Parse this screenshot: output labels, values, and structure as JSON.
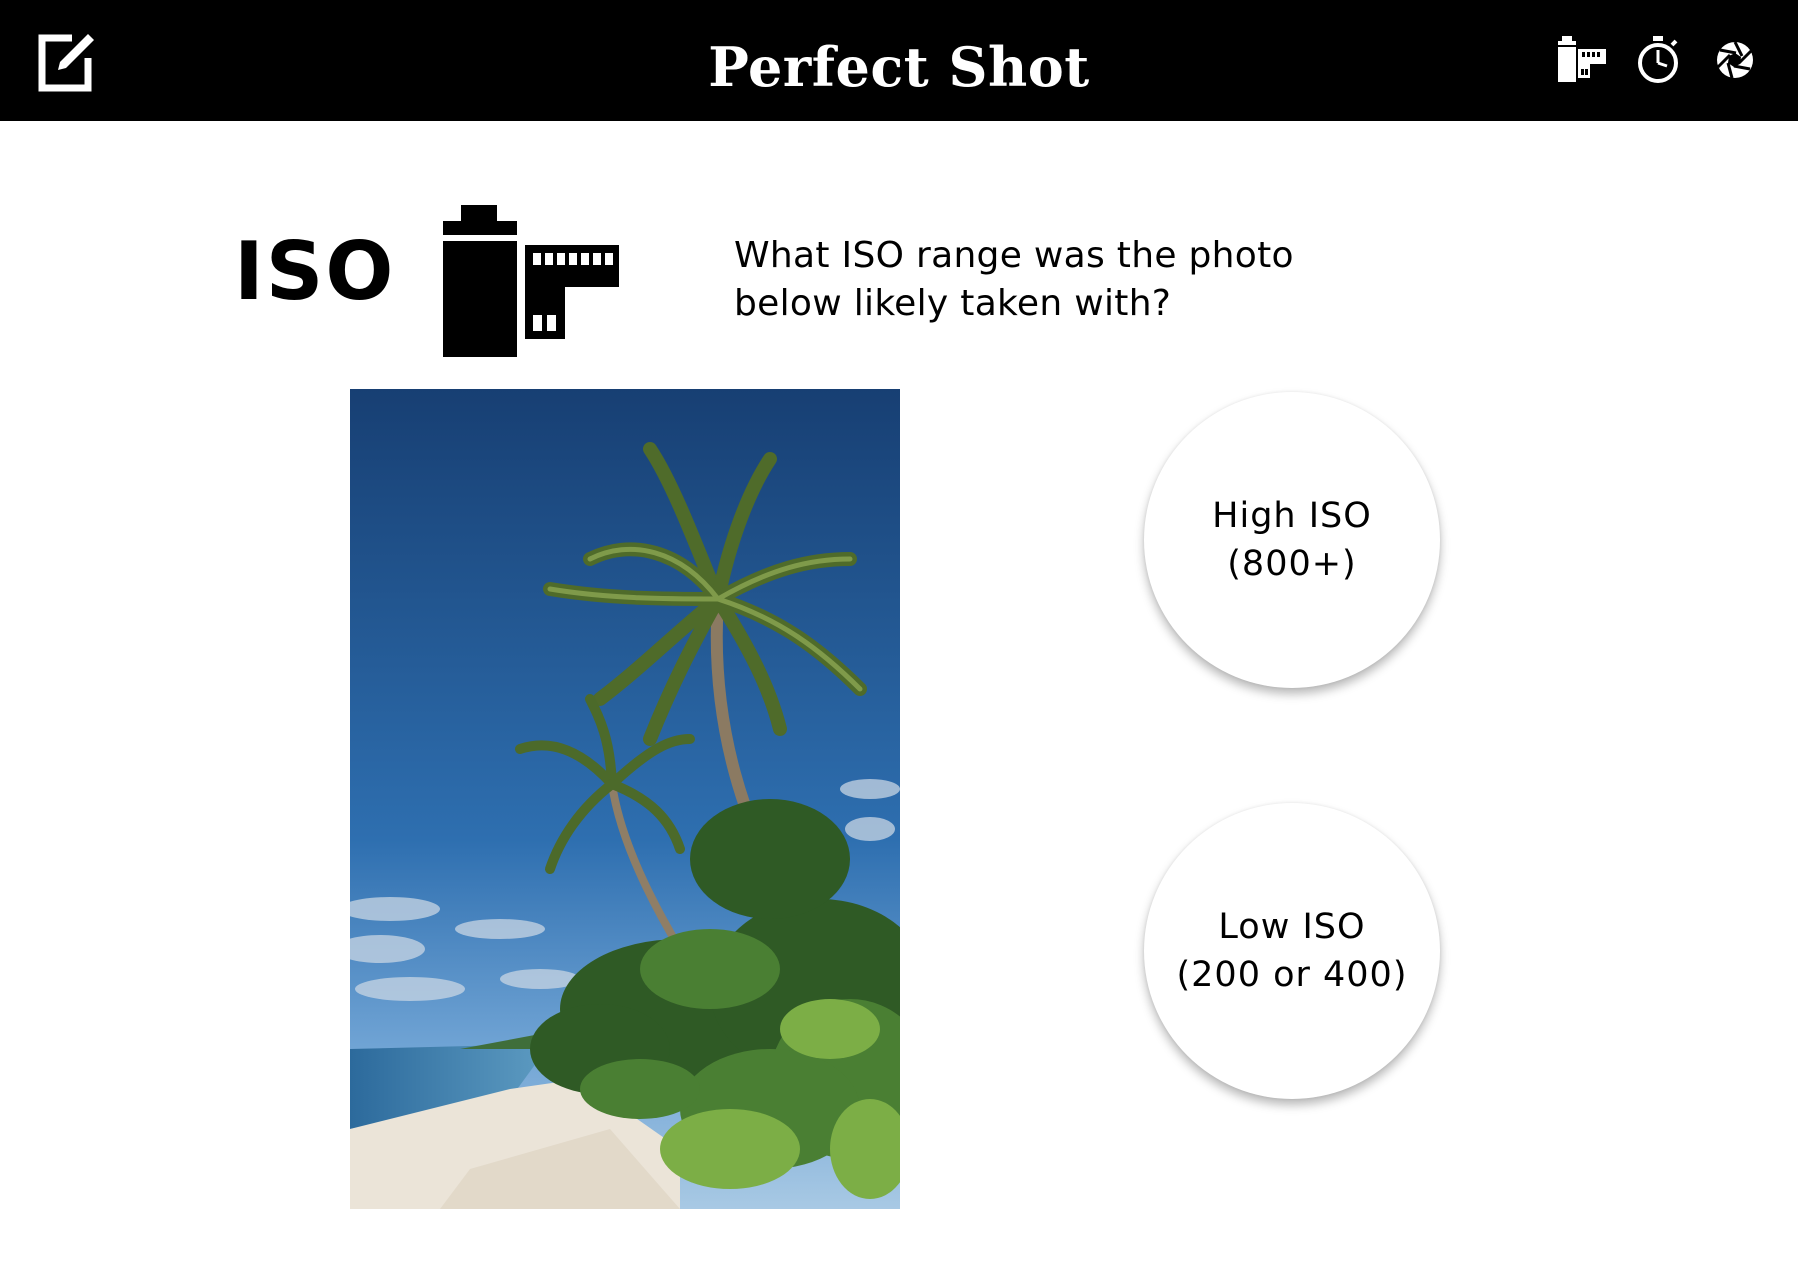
{
  "header": {
    "title": "Perfect Shot",
    "edit_icon": "edit-icon",
    "right_icons": [
      "film-roll-icon",
      "stopwatch-icon",
      "aperture-icon"
    ]
  },
  "question": {
    "category": "ISO",
    "category_icon": "film-roll-icon",
    "text": "What ISO range was the photo below likely taken with?"
  },
  "photo": {
    "subject": "beach-palm-trees-photo"
  },
  "answers": [
    {
      "label": "High ISO\n(800+)"
    },
    {
      "label": "Low ISO\n(200 or 400)"
    }
  ],
  "colors": {
    "header_bg": "#000000",
    "background": "#ffffff",
    "sky": "#1f4f86",
    "sand": "#e9e2d6"
  }
}
